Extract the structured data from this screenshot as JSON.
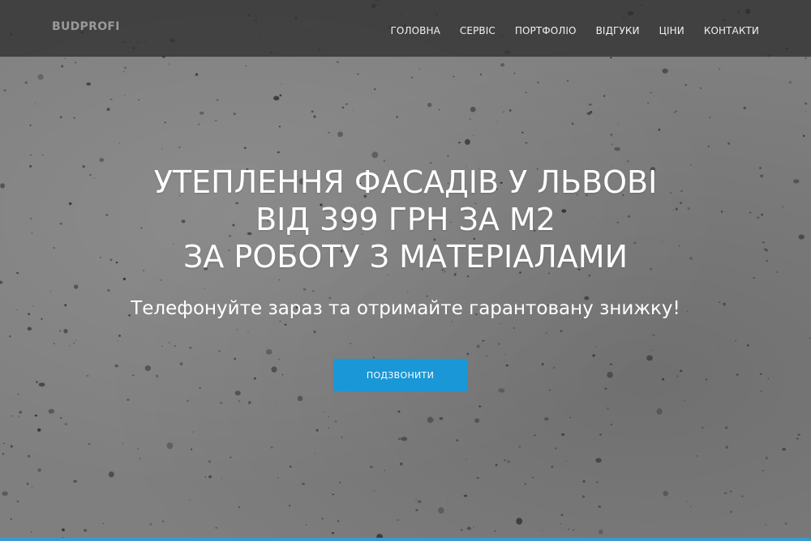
{
  "header": {
    "brand": "BUDPROFI",
    "nav": [
      {
        "label": "ГОЛОВНА"
      },
      {
        "label": "СЕРВІС"
      },
      {
        "label": "ПОРТФОЛІО"
      },
      {
        "label": "ВІДГУКИ"
      },
      {
        "label": "ЦІНИ"
      },
      {
        "label": "КОНТАКТИ"
      }
    ]
  },
  "hero": {
    "headline": [
      "УТЕПЛЕННЯ ФАСАДІВ У ЛЬВОВІ",
      "ВІД 399 ГРН ЗА М2",
      "ЗА РОБОТУ З МАТЕРІАЛАМИ"
    ],
    "subheadline": "Телефонуйте зараз та отримайте гарантовану знижку!",
    "cta_label": "ПОДЗВОНИТИ"
  },
  "colors": {
    "accent": "#1a97d6",
    "navbar": "#303030",
    "background": "#7f7f7f"
  }
}
